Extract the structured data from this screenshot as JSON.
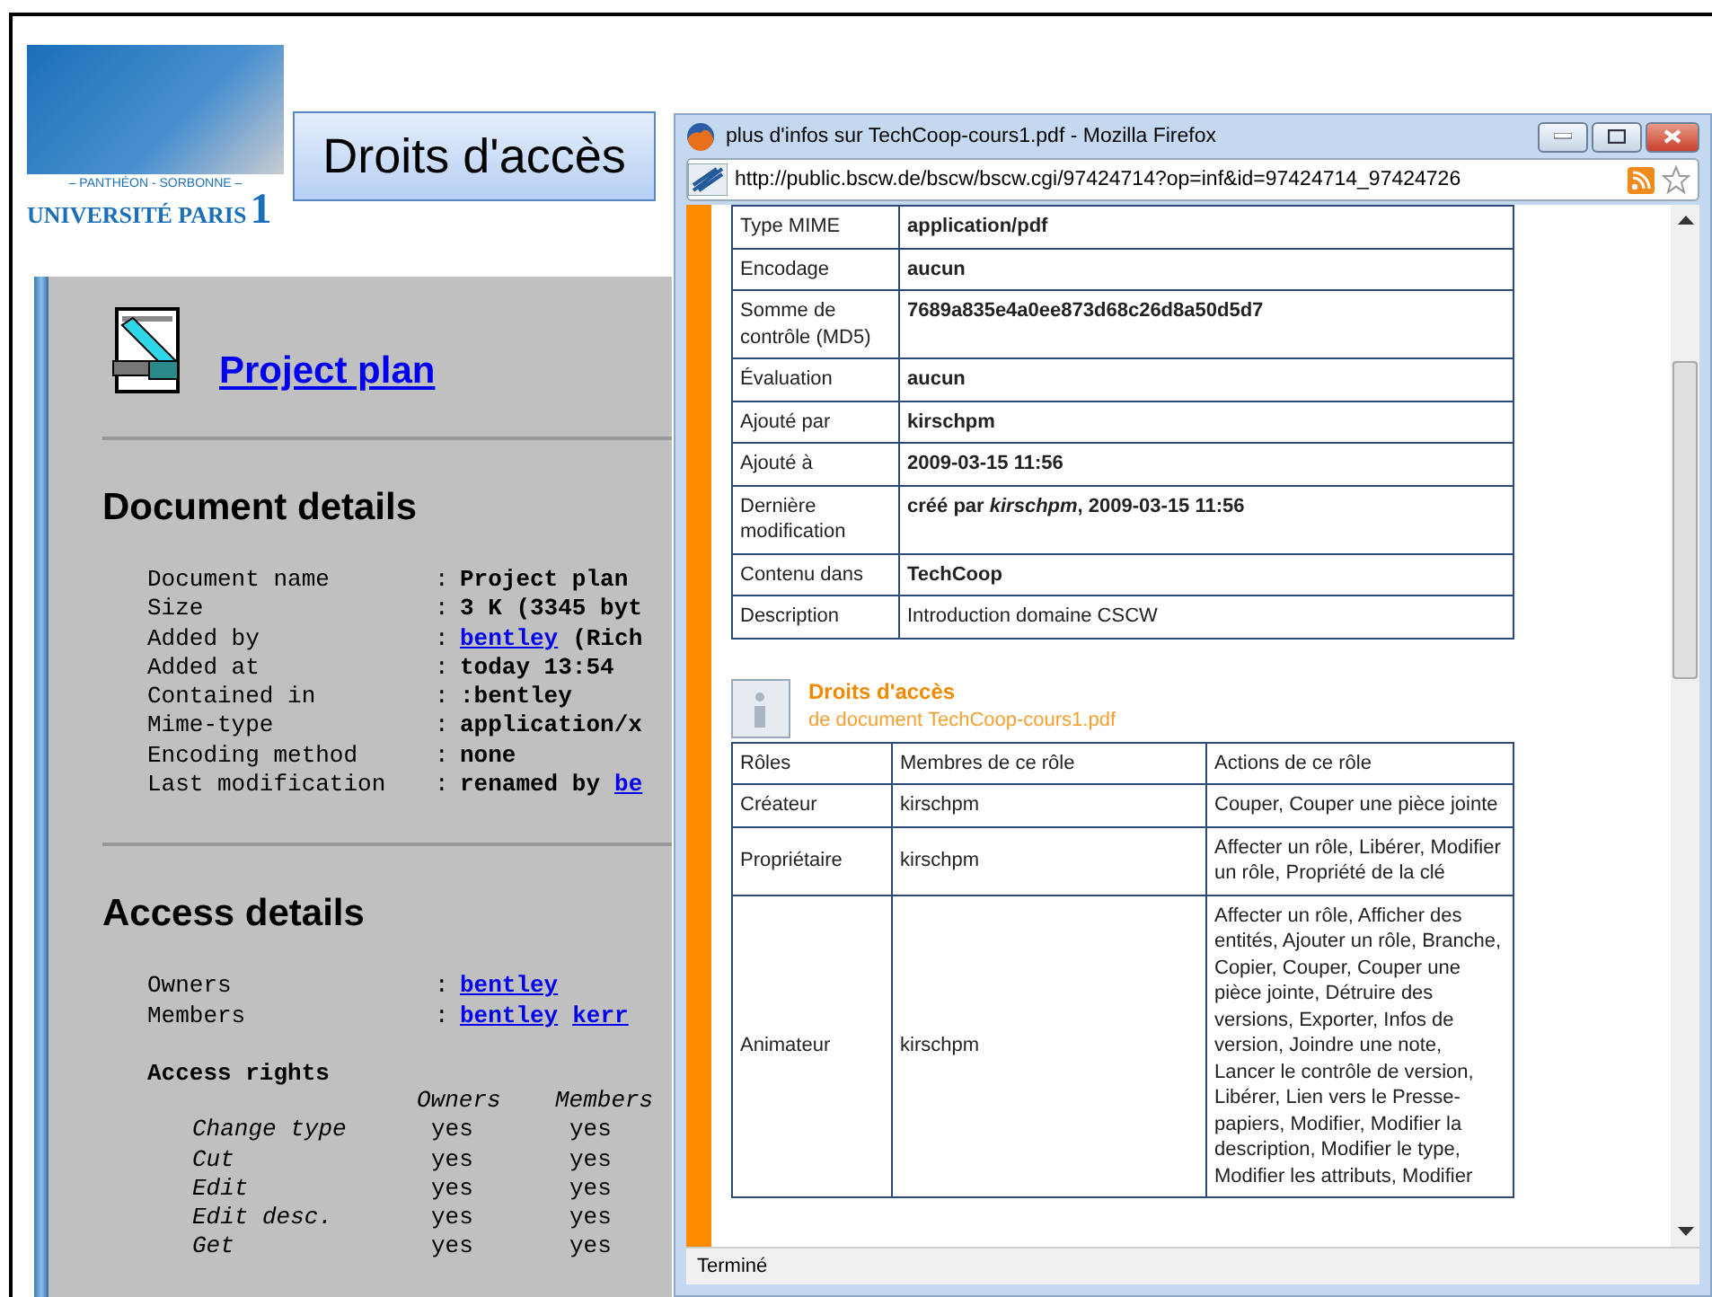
{
  "slide": {
    "title": "Droits d'accès",
    "logo": {
      "top_line": "– PANTHÉON - SORBONNE –",
      "name": "UNIVERSITÉ PARIS",
      "number": "1"
    }
  },
  "document_page": {
    "title": "Project plan",
    "details_heading": "Document details",
    "details": [
      {
        "label": "Document name",
        "separator": ":",
        "value": [
          {
            "text": "Project plan",
            "link": false
          }
        ]
      },
      {
        "label": "Size",
        "separator": ":",
        "value": [
          {
            "text": "3 K (3345 byt",
            "link": false
          }
        ]
      },
      {
        "label": "Added by",
        "separator": ":",
        "value": [
          {
            "text": "bentley",
            "link": true
          },
          {
            "text": "(Rich",
            "link": false
          }
        ]
      },
      {
        "label": "Added at",
        "separator": ":",
        "value": [
          {
            "text": "today 13:54",
            "link": false
          }
        ]
      },
      {
        "label": "Contained in",
        "separator": ":",
        "value": [
          {
            "text": ":bentley",
            "link": false
          }
        ]
      },
      {
        "label": "Mime-type",
        "separator": ":",
        "value": [
          {
            "text": "application/x",
            "link": false
          }
        ]
      },
      {
        "label": "Encoding method",
        "separator": ":",
        "value": [
          {
            "text": "none",
            "link": false
          }
        ]
      },
      {
        "label": "Last modification",
        "separator": ":",
        "value": [
          {
            "text": "renamed by",
            "link": false
          },
          {
            "text": "be",
            "link": true
          }
        ]
      }
    ],
    "access_heading": "Access details",
    "access": [
      {
        "label": "Owners",
        "separator": ":",
        "value": [
          {
            "text": "bentley",
            "link": true
          }
        ]
      },
      {
        "label": "Members",
        "separator": ":",
        "value": [
          {
            "text": "bentley",
            "link": true
          },
          {
            "text": "kerr",
            "link": true
          }
        ]
      }
    ],
    "rights_heading": "Access rights",
    "rights_columns": [
      "Owners",
      "Members"
    ],
    "rights": [
      {
        "name": "Change type",
        "values": [
          "yes",
          "yes"
        ]
      },
      {
        "name": "Cut",
        "values": [
          "yes",
          "yes"
        ]
      },
      {
        "name": "Edit",
        "values": [
          "yes",
          "yes"
        ]
      },
      {
        "name": "Edit desc.",
        "values": [
          "yes",
          "yes"
        ]
      },
      {
        "name": "Get",
        "values": [
          "yes",
          "yes"
        ]
      }
    ]
  },
  "browser": {
    "title": "plus d'infos sur TechCoop-cours1.pdf - Mozilla Firefox",
    "url": "http://public.bscw.de/bscw/bscw.cgi/97424714?op=inf&id=97424714_97424726",
    "properties": [
      {
        "label": "Type MIME",
        "value": "application/pdf",
        "bold": true
      },
      {
        "label": "Encodage",
        "value": "aucun",
        "bold": true
      },
      {
        "label": "Somme de contrôle (MD5)",
        "value": "7689a835e4a0ee873d68c26d8a50d5d7",
        "bold": true
      },
      {
        "label": "Évaluation",
        "value": "aucun",
        "bold": true
      },
      {
        "label": "Ajouté par",
        "value": "kirschpm",
        "bold": true
      },
      {
        "label": "Ajouté à",
        "value": "2009-03-15 11:56",
        "bold": true
      },
      {
        "label": "Dernière modification",
        "value": "créé par *kirschpm*, 2009-03-15 11:56",
        "bold": true
      },
      {
        "label": "Contenu dans",
        "value": "TechCoop",
        "bold": true
      },
      {
        "label": "Description",
        "value": "Introduction domaine CSCW",
        "bold": false
      }
    ],
    "section": {
      "title": "Droits d'accès",
      "subtitle": "de document TechCoop-cours1.pdf"
    },
    "roles": {
      "columns": [
        "Rôles",
        "Membres de ce rôle",
        "Actions de ce rôle"
      ],
      "rows": [
        [
          "Créateur",
          "kirschpm",
          "Couper, Couper une pièce jointe"
        ],
        [
          "Propriétaire",
          "kirschpm",
          "Affecter un rôle, Libérer, Modifier un rôle, Propriété de la clé"
        ],
        [
          "Animateur",
          "kirschpm",
          "Affecter un rôle, Afficher des entités, Ajouter un rôle, Branche, Copier, Couper, Couper une pièce jointe, Détruire des versions, Exporter, Infos de version, Joindre une note, Lancer le contrôle de version, Libérer, Lien vers le Presse-papiers, Modifier, Modifier la description, Modifier le type, Modifier les attributs, Modifier"
        ]
      ]
    },
    "status": "Terminé"
  }
}
